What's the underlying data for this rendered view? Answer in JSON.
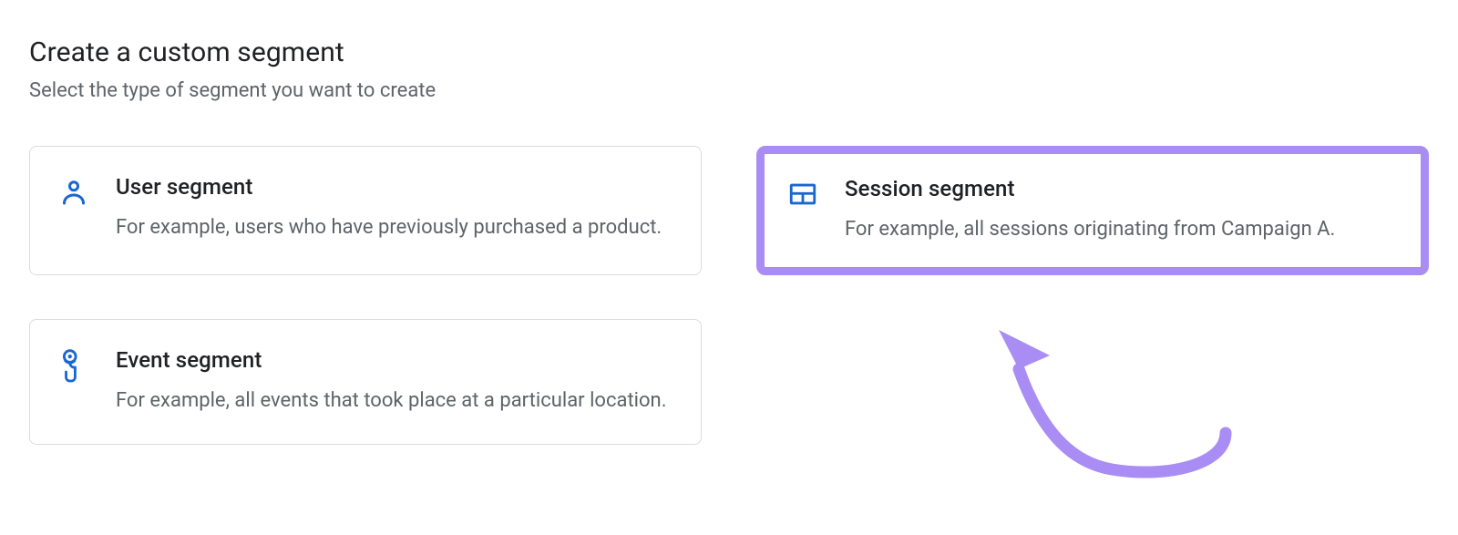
{
  "header": {
    "title": "Create a custom segment",
    "subtitle": "Select the type of segment you want to create"
  },
  "cards": {
    "user_segment": {
      "title": "User segment",
      "description": "For example, users who have previously purchased a product."
    },
    "session_segment": {
      "title": "Session segment",
      "description": "For example, all sessions originating from Campaign A."
    },
    "event_segment": {
      "title": "Event segment",
      "description": "For example, all events that took place at a particular location."
    }
  },
  "colors": {
    "icon_blue": "#1967d2",
    "highlight_purple": "#a98df5"
  }
}
